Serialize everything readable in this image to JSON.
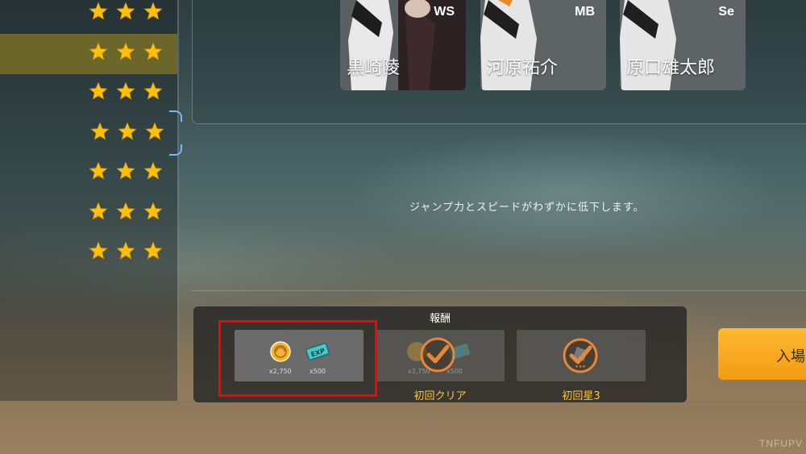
{
  "stage_list": {
    "rows": [
      {
        "stars": 3,
        "selected": false
      },
      {
        "stars": 3,
        "selected": true
      },
      {
        "stars": 3,
        "selected": false
      },
      {
        "stars": 3,
        "selected": false
      },
      {
        "stars": 3,
        "selected": false
      },
      {
        "stars": 3,
        "selected": false
      },
      {
        "stars": 3,
        "selected": false
      }
    ]
  },
  "characters": [
    {
      "name": "黒崎陵",
      "position": "WS"
    },
    {
      "name": "河原祐介",
      "position": "MB"
    },
    {
      "name": "原口雄太郎",
      "position": "Se"
    }
  ],
  "description": "ジャンプ力とスピードがわずかに低下します。",
  "reward": {
    "title": "報酬",
    "main_items": [
      {
        "icon": "coin-icon",
        "amount": "x2,750"
      },
      {
        "icon": "exp-ticket-icon",
        "amount": "x500"
      }
    ],
    "first_clear": {
      "label": "初回クリア",
      "amounts": [
        "x2,750",
        "x500"
      ]
    },
    "first_star3": {
      "label": "初回星3"
    }
  },
  "enter_button": {
    "label": "入場"
  },
  "watermark": "TNFUPV",
  "colors": {
    "star": "#ffc107",
    "accent": "#ffc53a",
    "button": "#f5a623",
    "highlight": "#ff0000"
  }
}
